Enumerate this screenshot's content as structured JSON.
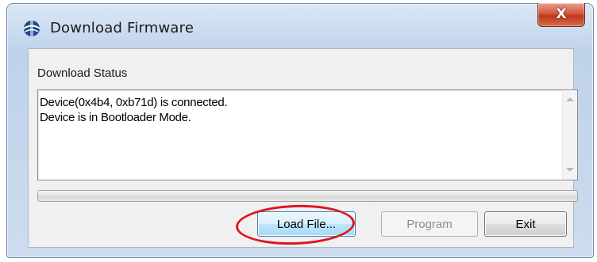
{
  "window": {
    "title": "Download Firmware",
    "icon": "firmware-globe-icon",
    "close_label": "X"
  },
  "group": {
    "label": "Download Status"
  },
  "status": {
    "lines": [
      "Device(0x4b4, 0xb71d) is connected.",
      "Device is in Bootloader Mode."
    ]
  },
  "progress": {
    "percent": 0
  },
  "buttons": {
    "load_file": "Load File...",
    "program": "Program",
    "exit": "Exit"
  },
  "colors": {
    "highlight": "#e0141e",
    "close_button": "#c1361d"
  }
}
